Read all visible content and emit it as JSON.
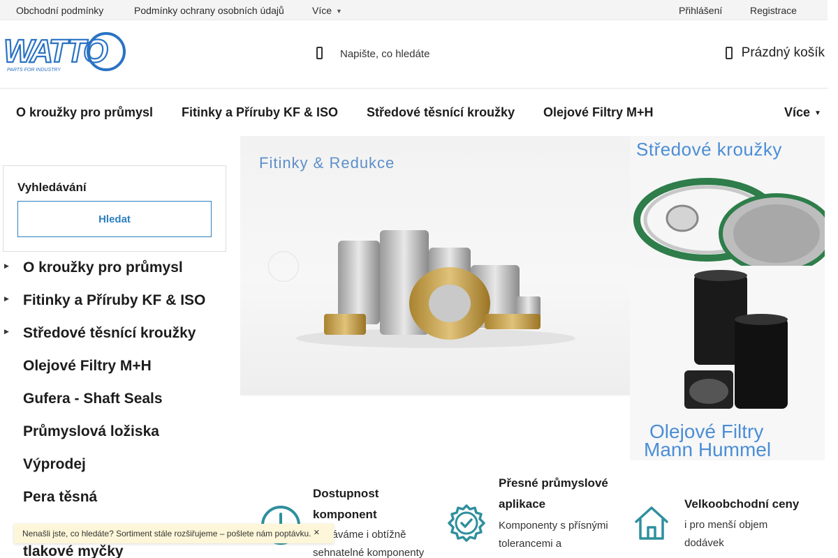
{
  "topbar": {
    "links": [
      "Obchodní podmínky",
      "Podmínky ochrany osobních údajů",
      "Více"
    ],
    "login": "Přihlášení",
    "register": "Registrace"
  },
  "header": {
    "logo_text": "WATTO",
    "logo_tagline": "PARTS FOR INDUSTRY",
    "search_placeholder": "Napište, co hledáte",
    "cart_label": "Prázdný košík"
  },
  "nav": {
    "items": [
      "O kroužky pro průmysl",
      "Fitinky a Příruby KF & ISO",
      "Středové těsnící kroužky",
      "Olejové Filtry M+H"
    ],
    "more": "Více"
  },
  "sidebar": {
    "search_title": "Vyhledávání",
    "search_button": "Hledat",
    "categories": [
      {
        "label": "O kroužky pro průmysl",
        "has_children": true
      },
      {
        "label": "Fitinky a Příruby KF & ISO",
        "has_children": true
      },
      {
        "label": "Středové těsnící kroužky",
        "has_children": true
      },
      {
        "label": "Olejové Filtry M+H",
        "has_children": false
      },
      {
        "label": "Gufera - Shaft Seals",
        "has_children": false
      },
      {
        "label": "Průmyslová ložiska",
        "has_children": false
      },
      {
        "label": "Výprodej",
        "has_children": false
      },
      {
        "label": "Pera těsná",
        "has_children": false
      },
      {
        "label": "Vysokotlaké hadice pro tlakové myčky",
        "has_children": false
      }
    ]
  },
  "banners": {
    "main_title": "Fitinky & Redukce",
    "right_top_title": "Středové kroužky",
    "right_bottom_line1": "Olejové Filtry",
    "right_bottom_line2": "Mann Hummel"
  },
  "features": [
    {
      "title": "Dostupnost komponent",
      "text": "Dodáváme i obtížně sehnatelné komponenty"
    },
    {
      "title": "Přesné průmyslové aplikace",
      "text": "Komponenty s přísnými tolerancemi a"
    },
    {
      "title": "Velkoobchodní ceny",
      "text": "i pro menší objem dodávek"
    }
  ],
  "toast": {
    "text": "Nenašli jste, co hledáte? Sortiment stále rozšiřujeme – pošlete nám poptávku."
  },
  "colors": {
    "accent": "#2a7fc1",
    "teal": "#2f8f9d",
    "banner_text": "#4b8ed6",
    "toast_bg": "#fdf6d8"
  },
  "icons": [
    "search-icon",
    "cart-icon",
    "chevron-down-icon",
    "clock-icon",
    "badge-check-icon",
    "home-icon",
    "close-icon"
  ]
}
